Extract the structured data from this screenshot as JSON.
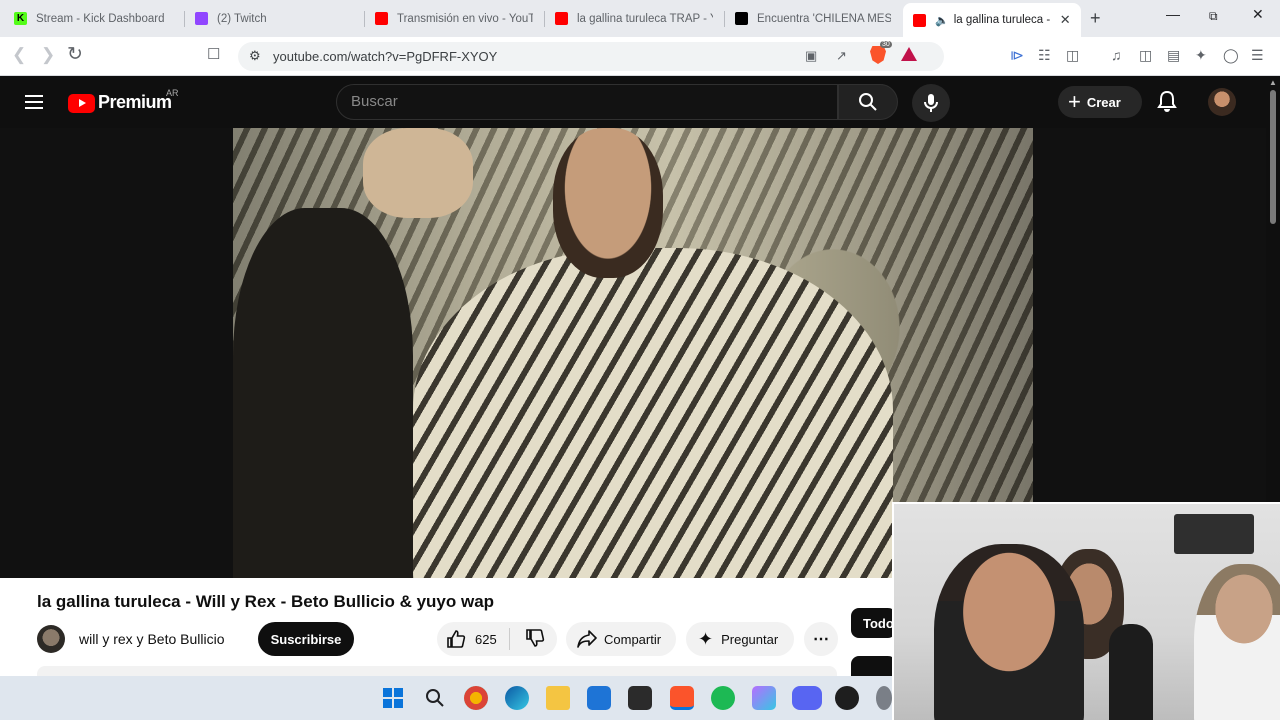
{
  "browser": {
    "tabs": [
      {
        "title": "Stream - Kick Dashboard",
        "favicon": "kick-icon"
      },
      {
        "title": "(2) Twitch",
        "favicon": "twitch-icon"
      },
      {
        "title": "Transmisión en vivo - YouT",
        "favicon": "youtube-icon"
      },
      {
        "title": "la gallina turuleca TRAP - Y",
        "favicon": "youtube-icon"
      },
      {
        "title": "Encuentra 'CHILENA MESS",
        "favicon": "tiktok-icon"
      },
      {
        "title": "la gallina turuleca -",
        "favicon": "youtube-icon",
        "active": true,
        "audio": true
      }
    ],
    "url": "youtube.com/watch?v=PgDFRF-XYOY",
    "brave_badge": "30"
  },
  "youtube": {
    "brand": "Premium",
    "country": "AR",
    "search_placeholder": "Buscar",
    "create_label": "Crear",
    "video": {
      "title": "la gallina turuleca - Will y Rex - Beto Bullicio & yuyo wap",
      "channel": "will y rex y Beto Bullicio",
      "subscribe_label": "Suscribirse",
      "likes": "625",
      "share_label": "Compartir",
      "ask_label": "Preguntar"
    },
    "chip_label": "Todo"
  },
  "colors": {
    "youtube_red": "#ff0000",
    "dark_bg": "#0f0f0f",
    "kick_green": "#53fc18",
    "twitch_purple": "#9146ff"
  },
  "taskbar": {
    "icons": [
      "windows-start-icon",
      "search-icon",
      "chrome-like-icon",
      "edge-icon",
      "file-explorer-icon",
      "store-icon",
      "sticky-notes-icon",
      "brave-icon",
      "spotify-icon",
      "app-icon",
      "discord-icon",
      "obs-icon",
      "settings-icon"
    ]
  }
}
